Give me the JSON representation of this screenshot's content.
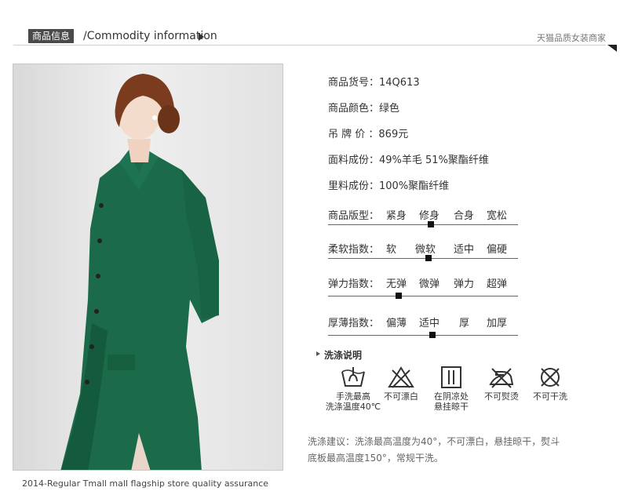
{
  "header": {
    "tag": "商品信息",
    "title": "/Commodity information",
    "right_text": "天猫品质女装商家"
  },
  "photo": {
    "alt": ""
  },
  "caption": "2014-Regular Tmall mall flagship store quality assurance",
  "details": [
    {
      "text": "商品货号：14Q613"
    },
    {
      "text": "商品颜色：绿色"
    },
    {
      "text": "吊 牌  价 ：869元"
    },
    {
      "text": "面料成份：49%羊毛 51%聚酯纤维"
    },
    {
      "text": "里料成份：100%聚酯纤维"
    }
  ],
  "scales": [
    {
      "label": "商品版型：",
      "options": [
        "紧身",
        "修身",
        "合身",
        "宽松"
      ],
      "selected_fraction": 0.54
    },
    {
      "label": "柔软指数：",
      "options": [
        "软",
        "微软",
        "适中",
        "偏硬"
      ],
      "selected_fraction": 0.53
    },
    {
      "label": "弹力指数：",
      "options": [
        "无弹",
        "微弹",
        "弹力",
        "超弹"
      ],
      "selected_fraction": 0.37
    },
    {
      "label": "厚薄指数：",
      "options": [
        "偏薄",
        "适中",
        "厚",
        "加厚"
      ],
      "selected_fraction": 0.55
    }
  ],
  "wash": {
    "title": "洗涤说明",
    "items": [
      {
        "icon": "hand-wash-icon",
        "label1": "手洗最高",
        "label2": "洗涤温度40℃"
      },
      {
        "icon": "no-bleach-icon",
        "label1": "不可漂白",
        "label2": ""
      },
      {
        "icon": "hang-dry-icon",
        "label1": "在阴凉处",
        "label2": "悬挂晾干"
      },
      {
        "icon": "no-iron-icon",
        "label1": "不可熨烫",
        "label2": ""
      },
      {
        "icon": "no-dry-clean-icon",
        "label1": "不可干洗",
        "label2": ""
      }
    ]
  },
  "advice": {
    "line1": "洗涤建议：洗涤最高温度为40°，不可漂白，悬挂晾干，熨斗",
    "line2": "底板最高温度150°，常规干洗。"
  }
}
